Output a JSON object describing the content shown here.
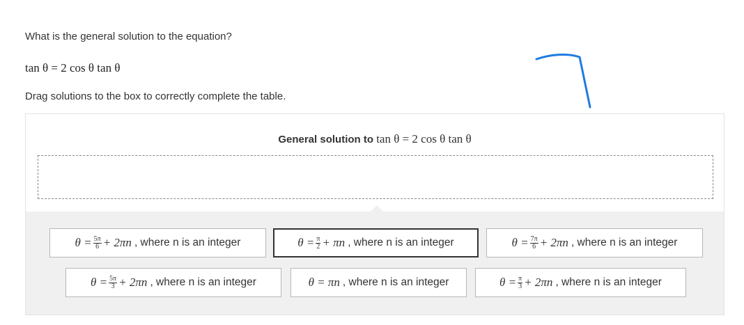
{
  "question": "What is the general solution to the equation?",
  "equation": "tan θ = 2 cos θ tan θ",
  "instructions": "Drag solutions to the box to correctly complete the table.",
  "table": {
    "header_label": "General solution to",
    "header_math": "tan θ = 2 cos θ tan θ"
  },
  "options": [
    {
      "lhs": "θ =",
      "num": "5π",
      "den": "6",
      "rest": "+ 2πn",
      "suffix": ", where n is an integer",
      "selected": false
    },
    {
      "lhs": "θ =",
      "num": "π",
      "den": "2",
      "rest": "+ πn",
      "suffix": ", where n is an integer",
      "selected": true
    },
    {
      "lhs": "θ =",
      "num": "7π",
      "den": "6",
      "rest": "+ 2πn",
      "suffix": ", where n is an integer",
      "selected": false
    },
    {
      "lhs": "θ =",
      "num": "5π",
      "den": "3",
      "rest": "+ 2πn",
      "suffix": ", where n is an integer",
      "selected": false
    },
    {
      "lhs": "θ = πn",
      "num": "",
      "den": "",
      "rest": "",
      "suffix": ", where n is an integer",
      "selected": false
    },
    {
      "lhs": "θ =",
      "num": "π",
      "den": "3",
      "rest": "+ 2πn",
      "suffix": ", where n is an integer",
      "selected": false
    }
  ],
  "colors": {
    "pen": "#1e7be0",
    "tray": "#f0f0f0",
    "tile_border": "#b7b7b7"
  }
}
